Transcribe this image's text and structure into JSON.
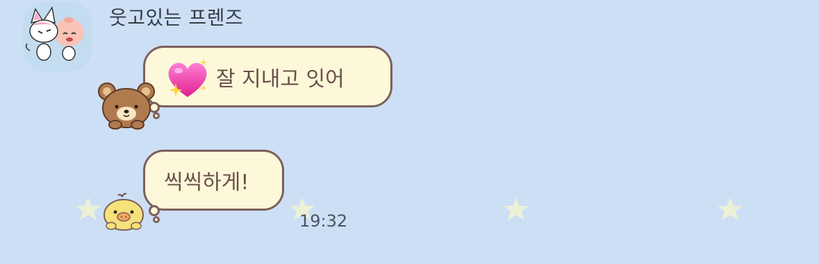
{
  "chat": {
    "sender_name": "웃고있는 프렌즈",
    "messages": [
      {
        "text": "잘 지내고 잇어",
        "icon": "sparkling-heart-emoji",
        "sticker": "brown-bear-icon"
      },
      {
        "text": "씩씩하게!",
        "sticker": "yellow-chick-icon",
        "time": "19:32"
      }
    ]
  },
  "colors": {
    "background": "#cddff5",
    "bubble_fill": "#fdf8da",
    "bubble_border": "#7c5f5b",
    "text": "#6b4f4b",
    "star": "#ecf0d6"
  }
}
